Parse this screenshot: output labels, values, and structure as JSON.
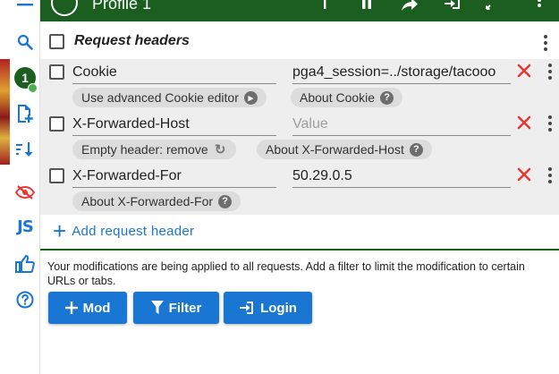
{
  "header": {
    "title": "Profile 1",
    "icons": [
      "add-icon",
      "pause-icon",
      "share-icon",
      "login-icon",
      "collapse-icon",
      "more-vert-icon"
    ]
  },
  "sidebar": {
    "profile_badge": "1",
    "js_label": "JS",
    "icons": [
      "menu-icon",
      "search-icon",
      "profile-icon",
      "add-file-icon",
      "sort-icon",
      "hide-icon",
      "js-icon",
      "thumbs-up-icon",
      "help-icon"
    ]
  },
  "section": {
    "title": "Request headers"
  },
  "headers": [
    {
      "name": "Cookie",
      "value": "pga4_session=../storage/tacooo",
      "value_placeholder": "",
      "chips": [
        {
          "label": "Use advanced Cookie editor",
          "icon": "arrow-right-icon"
        },
        {
          "label": "About Cookie",
          "icon": "help-icon"
        }
      ]
    },
    {
      "name": "X-Forwarded-Host",
      "value": "",
      "value_placeholder": "Value",
      "chips": [
        {
          "label": "Empty header: remove",
          "icon": "refresh-icon"
        },
        {
          "label": "About X-Forwarded-Host",
          "icon": "help-icon"
        }
      ]
    },
    {
      "name": "X-Forwarded-For",
      "value": "50.29.0.5",
      "value_placeholder": "",
      "chips": [
        {
          "label": "About X-Forwarded-For",
          "icon": "help-icon"
        }
      ]
    }
  ],
  "add_header_label": "Add request header",
  "footer_text": "Your modifications are being applied to all requests. Add a filter to limit the modification to certain URLs or tabs.",
  "buttons": {
    "mod": "Mod",
    "filter": "Filter",
    "login": "Login"
  },
  "colors": {
    "brand_green": "#1b5e20",
    "accent_blue": "#1976d2",
    "delete_red": "#e53935",
    "panel_gray": "#eeeeee"
  }
}
